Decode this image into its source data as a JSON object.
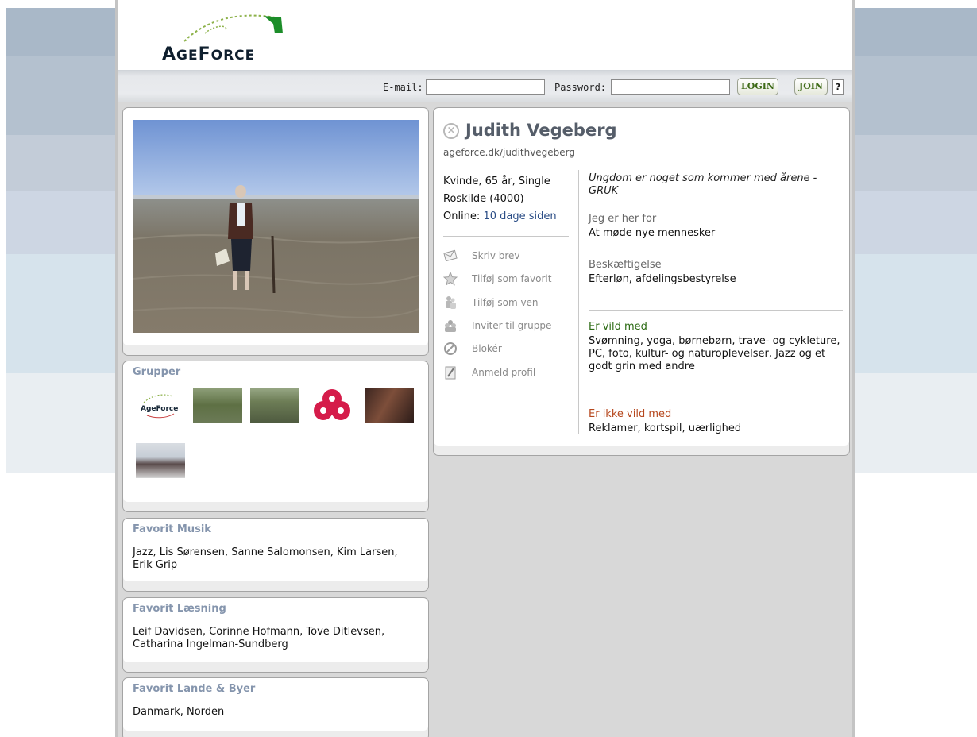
{
  "logo": {
    "text": "AgeForce"
  },
  "login": {
    "email_label": "E-mail:",
    "email_value": "",
    "password_label": "Password:",
    "password_value": "",
    "login_button": "LOGIN",
    "join_button": "JOIN",
    "help_button": "?"
  },
  "groups": {
    "title": "Grupper",
    "items": [
      "AgeForce",
      "group-photo-2",
      "group-photo-3",
      "group-logo-4",
      "group-photo-5",
      "group-photo-6"
    ]
  },
  "music": {
    "title": "Favorit Musik",
    "text": "Jazz, Lis Sørensen, Sanne Salomonsen, Kim Larsen, Erik Grip"
  },
  "reading": {
    "title": "Favorit Læsning",
    "text": "Leif Davidsen, Corinne Hofmann, Tove Ditlevsen, Catharina Ingelman-Sundberg"
  },
  "places": {
    "title": "Favorit Lande & Byer",
    "text": "Danmark, Norden"
  },
  "profile": {
    "name": "Judith Vegeberg",
    "url": "ageforce.dk/judithvegeberg",
    "basics": "Kvinde, 65 år, Single",
    "city": "Roskilde (4000)",
    "online_label": "Online:",
    "online_value": "10 dage siden",
    "motto": "Ungdom er noget som kommer med årene - GRUK",
    "here_for_label": "Jeg er her for",
    "here_for_value": "At møde nye mennesker",
    "occupation_label": "Beskæftigelse",
    "occupation_value": "Efterløn, afdelingsbestyrelse",
    "likes_label": "Er vild med",
    "likes_value": "Svømning, yoga, børnebørn, trave- og cykleture, PC, foto, kultur- og naturoplevelser, Jazz og et godt grin med andre",
    "dislikes_label": "Er ikke vild med",
    "dislikes_value": "Reklamer, kortspil, uærlighed"
  },
  "actions": [
    {
      "label": "Skriv brev",
      "icon": "envelope-icon"
    },
    {
      "label": "Tilføj som favorit",
      "icon": "star-icon"
    },
    {
      "label": "Tilføj som ven",
      "icon": "friends-icon"
    },
    {
      "label": "Inviter til gruppe",
      "icon": "group-icon"
    },
    {
      "label": "Blokér",
      "icon": "block-icon"
    },
    {
      "label": "Anmeld profil",
      "icon": "report-icon"
    }
  ],
  "colors": {
    "title_blue": "#8595ad",
    "link_blue": "#2b4d86",
    "likes_green": "#2b6a13",
    "dislikes_orange": "#b6481e",
    "button_green": "#3e6a17"
  }
}
